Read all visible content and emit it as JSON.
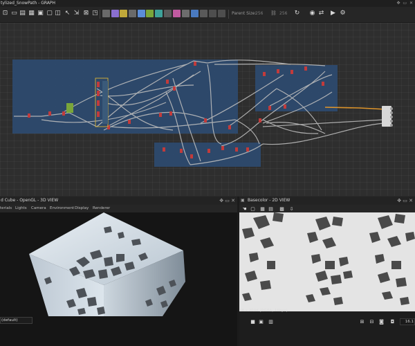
{
  "titlebar": {
    "title": "tylized_SnowPath - GRAPH",
    "window_icons": "✥ ▭ ✕"
  },
  "toolbar": {
    "parent_size_label": "Parent Size:",
    "parent_size_value": "256",
    "second_size_value": "256",
    "colors": {
      "green": "#7aa63a",
      "gray": "#5a5a5a",
      "purple": "#7d5ac2",
      "blue": "#3d75c0",
      "yellow": "#c7b23a",
      "teal": "#3ea29a",
      "red": "#c04a3a",
      "pink": "#c05aa0"
    }
  },
  "graph": {
    "frame_color": "#2d4a6e",
    "wire_color": "#b8b8b8",
    "highlight_wire_color": "#e0962b",
    "node_red": "#c23b3b"
  },
  "view3d": {
    "header": "d Cube - OpenGL - 3D VIEW",
    "header_icons": "✥ ▭ ✕",
    "menu": [
      "terials",
      "Lights",
      "Camera",
      "Environment",
      "Display",
      "Renderer"
    ],
    "selector": "(default)"
  },
  "view2d": {
    "header": "Basecolor - 2D VIEW",
    "header_icons": "✥ ▭ ✕",
    "resolution": "48 x 2048 (RGBA, 16bpc)",
    "zoom": "16.1"
  }
}
